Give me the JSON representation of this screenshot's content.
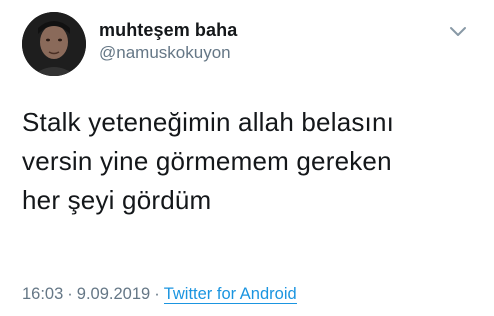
{
  "user": {
    "display_name": "muhteşem baha",
    "handle": "@namuskokuyon",
    "avatar_icon": "profile-photo"
  },
  "tweet": {
    "lines": [
      "Stalk yeteneğimin allah belasını",
      "versin yine görmemem gereken",
      "her şeyi gördüm"
    ]
  },
  "meta": {
    "time": "16:03",
    "separator1": "·",
    "date": "9.09.2019",
    "separator2": "·",
    "source": "Twitter for Android"
  },
  "menu": {
    "icon": "chevron-down-icon"
  },
  "colors": {
    "text": "#14171a",
    "secondary": "#657786",
    "link": "#1b95e0",
    "background": "#ffffff"
  }
}
